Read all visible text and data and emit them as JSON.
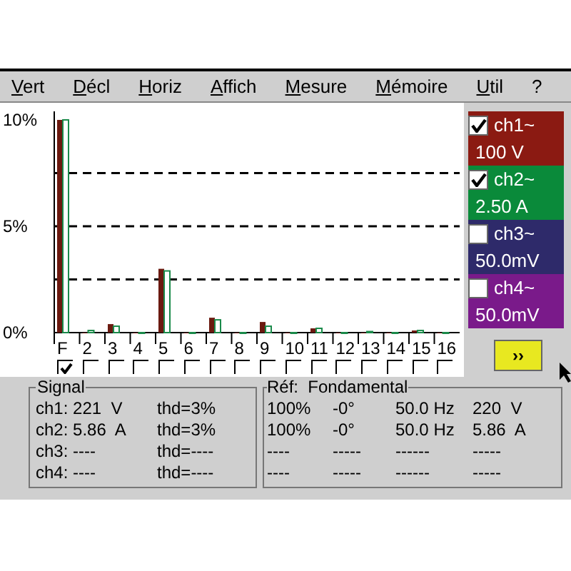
{
  "menu": [
    "Vert",
    "Décl",
    "Horiz",
    "Affich",
    "Mesure",
    "Mémoire",
    "Util",
    "?"
  ],
  "chart": {
    "chart_data": {
      "type": "bar",
      "categories": [
        "F",
        "2",
        "3",
        "4",
        "5",
        "6",
        "7",
        "8",
        "9",
        "10",
        "11",
        "12",
        "13",
        "14",
        "15",
        "16"
      ],
      "series": [
        {
          "color": "#6b1a10",
          "values": [
            10,
            0,
            0.4,
            0,
            3.0,
            0,
            0.7,
            0,
            0.5,
            0,
            0.2,
            0,
            0,
            0,
            0.1,
            0
          ]
        },
        {
          "color": "#1a8a4a",
          "values": [
            10,
            0.1,
            0.3,
            0,
            2.9,
            0,
            0.6,
            0,
            0.3,
            0,
            0.2,
            0,
            0.05,
            0,
            0.1,
            0
          ]
        }
      ],
      "ylim": [
        0,
        10
      ],
      "yticks": [
        {
          "value": 0,
          "label": "0%"
        },
        {
          "value": 5,
          "label": "5%"
        },
        {
          "value": 10,
          "label": "10%"
        }
      ]
    }
  },
  "harmonic_toggles": [
    {
      "checked": true
    },
    {
      "checked": false
    },
    {
      "checked": false
    },
    {
      "checked": false
    },
    {
      "checked": false
    },
    {
      "checked": false
    },
    {
      "checked": false
    },
    {
      "checked": false
    },
    {
      "checked": false
    },
    {
      "checked": false
    },
    {
      "checked": false
    },
    {
      "checked": false
    },
    {
      "checked": false
    },
    {
      "checked": false
    },
    {
      "checked": false
    },
    {
      "checked": false
    }
  ],
  "channels": [
    {
      "name": "ch1~",
      "value": "100 V",
      "checked": true,
      "color": "#8b1a12"
    },
    {
      "name": "ch2~",
      "value": "2.50 A",
      "checked": true,
      "color": "#0a8a3a"
    },
    {
      "name": "ch3~",
      "value": "50.0mV",
      "checked": false,
      "color": "#2e2a6a"
    },
    {
      "name": "ch4~",
      "value": "50.0mV",
      "checked": false,
      "color": "#7a1a8a"
    }
  ],
  "next_button": "››",
  "signal": {
    "title": "Signal",
    "rows": [
      {
        "reading": "ch1: 221  V",
        "thd": "thd=3%"
      },
      {
        "reading": "ch2: 5.86  A",
        "thd": "thd=3%"
      },
      {
        "reading": "ch3: ----",
        "thd": "thd=----"
      },
      {
        "reading": "ch4: ----",
        "thd": "thd=----"
      }
    ]
  },
  "reference": {
    "title": "Réf:  Fondamental",
    "rows": [
      {
        "columns": [
          "100%",
          "-0°",
          "50.0 Hz",
          "220  V"
        ]
      },
      {
        "columns": [
          "100%",
          "-0°",
          "50.0 Hz",
          "5.86  A"
        ]
      },
      {
        "columns": [
          "----",
          "-----",
          "------",
          "-----"
        ]
      },
      {
        "columns": [
          "----",
          "-----",
          "------",
          "-----"
        ]
      }
    ]
  }
}
